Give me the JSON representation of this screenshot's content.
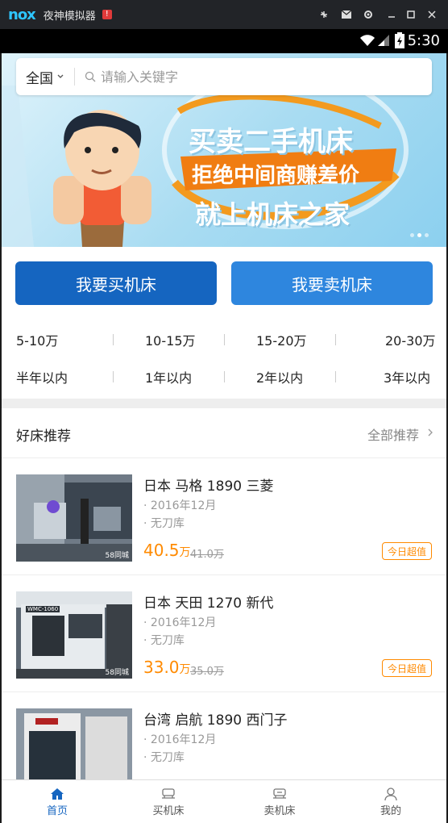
{
  "emulator": {
    "logo": "nox",
    "title": "夜神模拟器",
    "alert": "!"
  },
  "status": {
    "time": "5:30"
  },
  "search": {
    "region": "全国",
    "placeholder": "请输入关键字"
  },
  "banner": {
    "line1": "买卖二手机床",
    "line2": "拒绝中间商赚差价",
    "line3": "就上机床之家"
  },
  "cta": {
    "buy": "我要买机床",
    "sell": "我要卖机床"
  },
  "price_filters": [
    "5-10万",
    "10-15万",
    "15-20万",
    "20-30万"
  ],
  "age_filters": [
    "半年以内",
    "1年以内",
    "2年以内",
    "3年以内"
  ],
  "recommend": {
    "title": "好床推荐",
    "all": "全部推荐"
  },
  "listings": [
    {
      "title": "日本 马格 1890 三菱",
      "date": "2016年12月",
      "tool": "无刀库",
      "price": "40.5",
      "unit": "万",
      "old_price": "41.0万",
      "badge": "今日超值",
      "watermark": "58同城"
    },
    {
      "title": "日本 天田 1270 新代",
      "date": "2016年12月",
      "tool": "无刀库",
      "price": "33.0",
      "unit": "万",
      "old_price": "35.0万",
      "badge": "今日超值",
      "watermark": "58同城",
      "machine_label": "WMC-1060"
    },
    {
      "title": "台湾 启航 1890 西门子",
      "date": "2016年12月",
      "tool": "无刀库",
      "price": "",
      "unit": "",
      "old_price": "",
      "badge": ""
    }
  ],
  "tabs": [
    {
      "label": "首页",
      "icon": "home-icon"
    },
    {
      "label": "买机床",
      "icon": "buy-machine-icon"
    },
    {
      "label": "卖机床",
      "icon": "sell-machine-icon"
    },
    {
      "label": "我的",
      "icon": "profile-icon"
    }
  ],
  "colors": {
    "primary": "#1565c0",
    "secondary": "#2e86de",
    "accent": "#ff8a00"
  }
}
